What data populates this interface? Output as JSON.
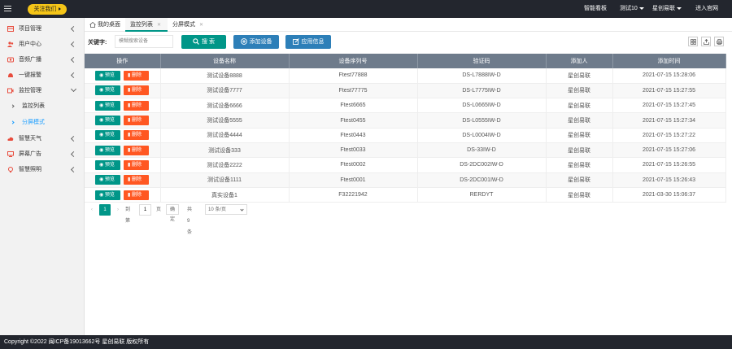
{
  "topbar": {
    "follow_label": "关注我们",
    "links": [
      "智能看板",
      "测试10",
      "星创易联",
      "进入官网"
    ]
  },
  "sidebar": {
    "items": [
      {
        "label": "项目管理",
        "icon": "building-icon",
        "color": "#e84c3d"
      },
      {
        "label": "用户中心",
        "icon": "users-icon",
        "color": "#e84c3d"
      },
      {
        "label": "音频广播",
        "icon": "speaker-icon",
        "color": "#e84c3d"
      },
      {
        "label": "一键报警",
        "icon": "alarm-icon",
        "color": "#e84c3d"
      },
      {
        "label": "监控管理",
        "icon": "camera-icon",
        "color": "#e84c3d"
      },
      {
        "label": "智慧天气",
        "icon": "cloud-icon",
        "color": "#e84c3d"
      },
      {
        "label": "屏幕广告",
        "icon": "monitor-icon",
        "color": "#e84c3d"
      },
      {
        "label": "智慧照明",
        "icon": "bulb-icon",
        "color": "#e84c3d"
      }
    ],
    "sub_items": [
      {
        "label": "监控列表"
      },
      {
        "label": "分屏模式"
      }
    ]
  },
  "tabs": [
    {
      "label": "我的桌面"
    },
    {
      "label": "监控列表"
    },
    {
      "label": "分屏模式"
    }
  ],
  "search": {
    "keyword_label": "关键字:",
    "placeholder": "模糊搜索设备",
    "search_label": "搜 索",
    "add_label": "添加设备",
    "app_label": "应用信息"
  },
  "table": {
    "headers": [
      "操作",
      "设备名称",
      "设备序列号",
      "验证码",
      "添加人",
      "添加时间"
    ],
    "preview_label": "预览",
    "delete_label": "删除",
    "rows": [
      [
        "测试设备8888",
        "Ftest77888",
        "DS-L7888IW-D",
        "星创易联",
        "2021-07-15 15:28:06"
      ],
      [
        "测试设备7777",
        "Ftest77775",
        "DS-L7775IW-D",
        "星创易联",
        "2021-07-15 15:27:55"
      ],
      [
        "测试设备6666",
        "Ftest6665",
        "DS-L0665IW-D",
        "星创易联",
        "2021-07-15 15:27:45"
      ],
      [
        "测试设备5555",
        "Ftest0455",
        "DS-L0555IW-D",
        "星创易联",
        "2021-07-15 15:27:34"
      ],
      [
        "测试设备4444",
        "Ftest0443",
        "DS-L0004IW-D",
        "星创易联",
        "2021-07-15 15:27:22"
      ],
      [
        "测试设备333",
        "Ftest0033",
        "DS-33IW-D",
        "星创易联",
        "2021-07-15 15:27:06"
      ],
      [
        "测试设备2222",
        "Ftest0002",
        "DS-2DC002IW-D",
        "星创易联",
        "2021-07-15 15:26:55"
      ],
      [
        "测试设备1111",
        "Ftest0001",
        "DS-2DC001IW-D",
        "星创易联",
        "2021-07-15 15:26:43"
      ],
      [
        "真实设备1",
        "F32221942",
        "RERDYT",
        "星创易联",
        "2021-03-30 15:06:37"
      ]
    ]
  },
  "pager": {
    "prev": "‹",
    "current": "1",
    "next": "›",
    "goto_label": "到第",
    "goto_value": "1",
    "page_label": "页",
    "confirm_label": "确定",
    "total_label": "共 9 条",
    "size_label": "10 条/页"
  },
  "footer": {
    "text": "Copyright ©2022 闽ICP备19013662号 星创易联 版权所有"
  }
}
